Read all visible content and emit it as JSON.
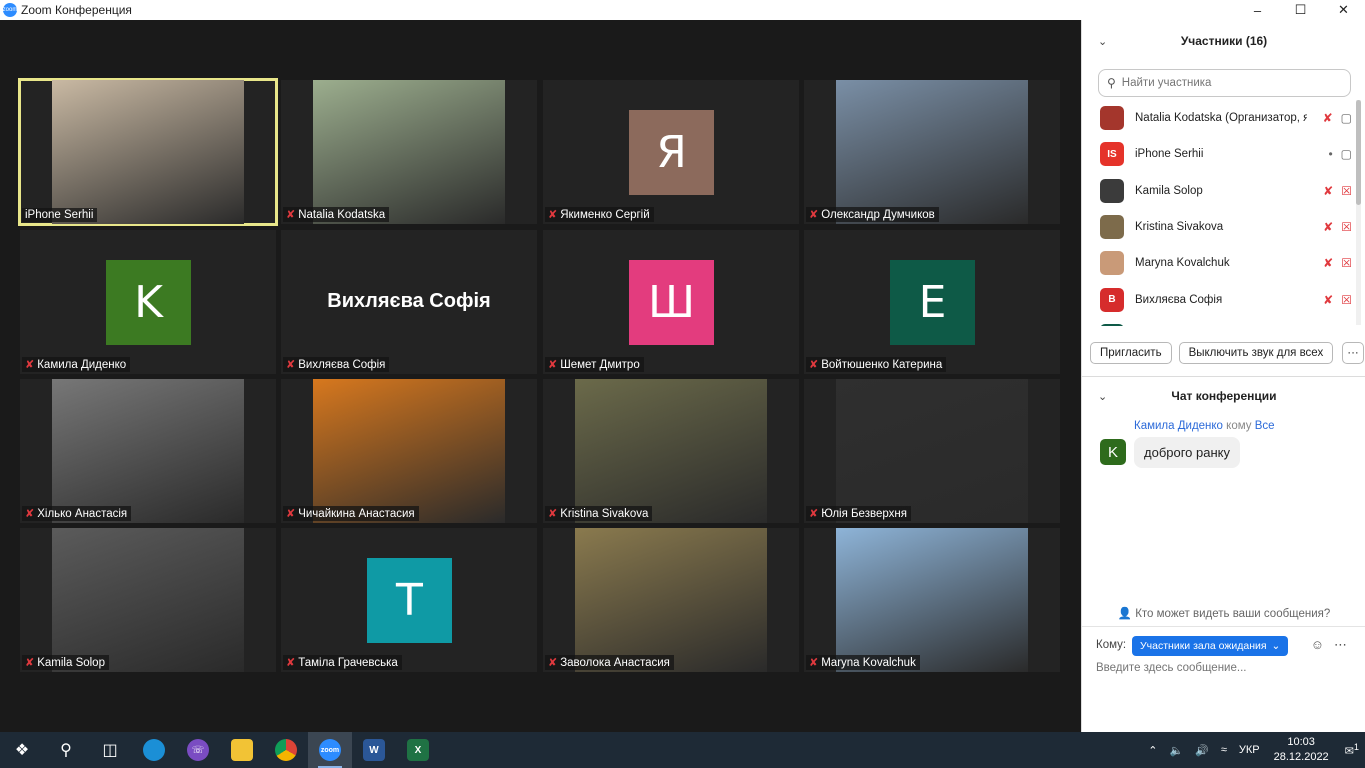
{
  "window": {
    "title": "Zoom Конференция",
    "controls": [
      "–",
      "☐",
      "✕"
    ]
  },
  "tiles": [
    {
      "name": "iPhone Serhii",
      "muted": false,
      "kind": "photo",
      "active": true,
      "color": "#c9b9a3"
    },
    {
      "name": "Natalia Kodatska",
      "muted": true,
      "kind": "photo",
      "color": "#9cae8e"
    },
    {
      "name": "Якименко Сергій",
      "muted": true,
      "kind": "avatar",
      "letter": "Я",
      "color": "#8c6a5c"
    },
    {
      "name": "Олександр Думчиков",
      "muted": true,
      "kind": "photo",
      "color": "#7a8fa6"
    },
    {
      "name": "Камила Диденко",
      "muted": true,
      "kind": "avatar",
      "letter": "K",
      "color": "#3c7a22"
    },
    {
      "name": "Вихляєва Софія",
      "muted": true,
      "kind": "bigname",
      "bigname": "Вихляєва Софія"
    },
    {
      "name": "Шемет Дмитро",
      "muted": true,
      "kind": "avatar",
      "letter": "Ш",
      "color": "#e33c7e"
    },
    {
      "name": "Войтюшенко Катерина",
      "muted": true,
      "kind": "avatar",
      "letter": "E",
      "color": "#0e5a47"
    },
    {
      "name": "Хілько  Анастасія",
      "muted": true,
      "kind": "photo",
      "color": "#777777"
    },
    {
      "name": "Чичайкина Анастасия",
      "muted": true,
      "kind": "photo",
      "color": "#d7781e"
    },
    {
      "name": "Kristina Sivakova",
      "muted": true,
      "kind": "photo",
      "color": "#6b6a4a"
    },
    {
      "name": "Юлія Безверхня",
      "muted": true,
      "kind": "photo",
      "color": "#2f2f2f"
    },
    {
      "name": "Kamila Solop",
      "muted": true,
      "kind": "photo",
      "color": "#5b5b5b"
    },
    {
      "name": "Таміла Грачевська",
      "muted": true,
      "kind": "avatar",
      "letter": "T",
      "color": "#0f9aa5"
    },
    {
      "name": "Заволока Анастасия",
      "muted": true,
      "kind": "photo",
      "color": "#8a7a4e"
    },
    {
      "name": "Maryna Kovalchuk",
      "muted": true,
      "kind": "photo",
      "color": "#8eb4d8"
    }
  ],
  "participants": {
    "title": "Участники (16)",
    "search_placeholder": "Найти участника",
    "list": [
      {
        "name": "Natalia Kodatska (Организатор, я)",
        "initials": "",
        "color": "#a4362c",
        "mic_muted": true,
        "video_off": false
      },
      {
        "name": "iPhone Serhii",
        "initials": "IS",
        "color": "#e5332a",
        "mic_muted": false,
        "video_off": false
      },
      {
        "name": "Kamila Solop",
        "initials": "",
        "color": "#3b3b3b",
        "mic_muted": true,
        "video_off": true
      },
      {
        "name": "Kristina Sivakova",
        "initials": "",
        "color": "#7d6b4b",
        "mic_muted": true,
        "video_off": true
      },
      {
        "name": "Maryna Kovalchuk",
        "initials": "",
        "color": "#c99a78",
        "mic_muted": true,
        "video_off": true
      },
      {
        "name": "Вихляєва Софія",
        "initials": "B",
        "color": "#d62c2c",
        "mic_muted": true,
        "video_off": true
      },
      {
        "name": "",
        "initials": "",
        "color": "#0e5a47",
        "mic_muted": false,
        "video_off": false
      }
    ],
    "invite_label": "Пригласить",
    "mute_all_label": "Выключить звук для всех",
    "more_label": "···"
  },
  "chat": {
    "title": "Чат конференции",
    "messages": [
      {
        "sender": "Камила Диденко",
        "to_word": "кому",
        "recipient": "Все",
        "text": "доброго ранку",
        "initial": "K"
      }
    ],
    "who_sees": "Кто может видеть ваши сообщения?",
    "to_label": "Кому:",
    "to_value": "Участники зала ожидания",
    "input_placeholder": "Введите здесь сообщение..."
  },
  "taskbar": {
    "lang": "УКР",
    "time": "10:03",
    "date": "28.12.2022",
    "notifications": "1"
  }
}
